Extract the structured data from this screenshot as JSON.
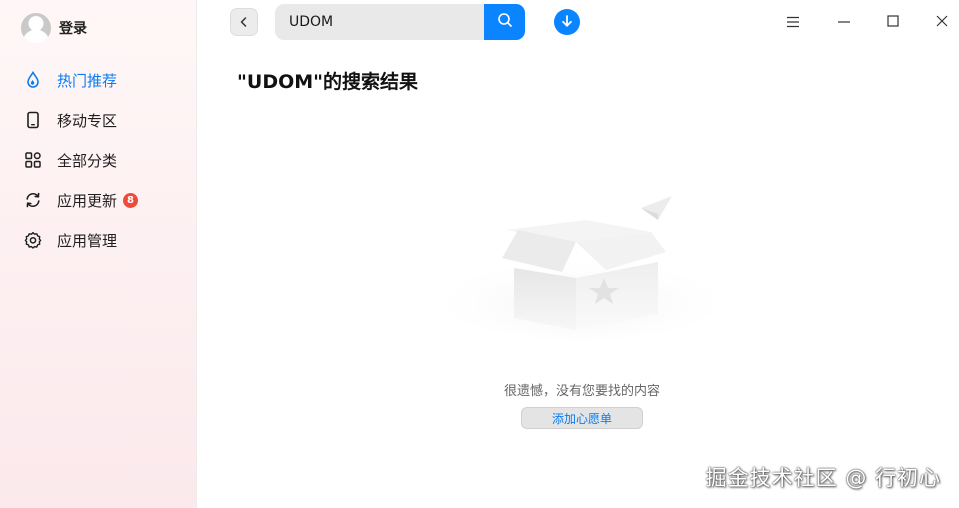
{
  "user": {
    "login_label": "登录"
  },
  "sidebar": {
    "items": [
      {
        "label": "热门推荐",
        "icon": "droplet-icon",
        "active": true
      },
      {
        "label": "移动专区",
        "icon": "phone-icon"
      },
      {
        "label": "全部分类",
        "icon": "grid-icon"
      },
      {
        "label": "应用更新",
        "icon": "refresh-icon",
        "badge": "8"
      },
      {
        "label": "应用管理",
        "icon": "gear-icon"
      }
    ]
  },
  "search": {
    "value": "UDOM",
    "placeholder": ""
  },
  "main": {
    "title": "\"UDOM\"的搜索结果",
    "empty_message": "很遗憾，没有您要找的内容",
    "wishlist_button": "添加心愿单"
  },
  "watermark": "掘金技术社区 @ 行初心",
  "colors": {
    "accent": "#0a84ff",
    "badge": "#f04a3b",
    "active_nav": "#0a7cf3"
  }
}
